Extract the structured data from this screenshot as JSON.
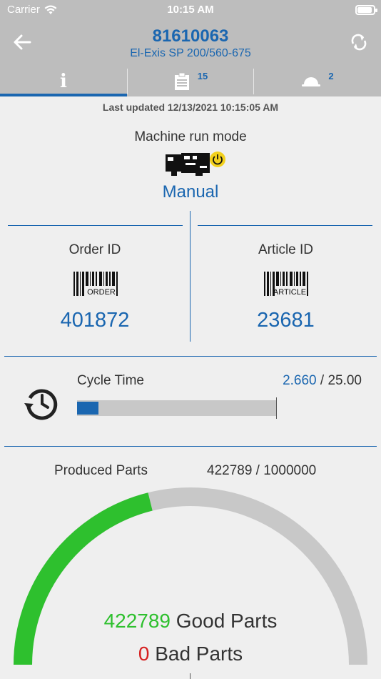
{
  "status_bar": {
    "carrier": "Carrier",
    "time": "10:15 AM"
  },
  "header": {
    "title": "81610063",
    "subtitle": "El-Exis SP 200/560-675"
  },
  "tabs": [
    {
      "name": "info",
      "icon": "info-icon",
      "badge": ""
    },
    {
      "name": "orders",
      "icon": "clipboard-icon",
      "badge": "15"
    },
    {
      "name": "alarms",
      "icon": "helmet-icon",
      "badge": "2"
    }
  ],
  "last_updated": "Last updated 12/13/2021 10:15:05 AM",
  "run_mode": {
    "label": "Machine run mode",
    "value": "Manual"
  },
  "order": {
    "label": "Order ID",
    "barcode_text": "ORDER",
    "value": "401872"
  },
  "article": {
    "label": "Article ID",
    "barcode_text": "ARTICLE",
    "value": "23681"
  },
  "cycle_time": {
    "label": "Cycle Time",
    "current": "2.660",
    "separator": " / ",
    "target": "25.00",
    "progress_fraction": 0.1064
  },
  "produced": {
    "label": "Produced Parts",
    "values": "422789 / 1000000",
    "good_count": "422789",
    "good_label": "Good Parts",
    "bad_count": "0",
    "bad_label": "Bad Parts",
    "progress_fraction": 0.4228
  },
  "colors": {
    "accent": "#1a66b0",
    "header_bg": "#bdbdbd",
    "good": "#2ec02e",
    "bad": "#d62020",
    "track": "#c8c8c8"
  }
}
